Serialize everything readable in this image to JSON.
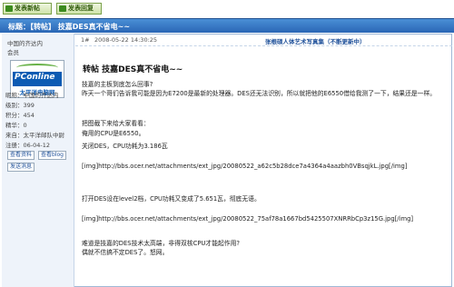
{
  "toolbar": {
    "new_post": "发表新帖",
    "reply": "发表回复"
  },
  "thread": {
    "title": "标题：【转帖】 技嘉DES真不省电~~"
  },
  "author": {
    "name": "中国的齐达内",
    "role": "会员",
    "logo_main": "PConline",
    "logo_sub": "太平洋电脑网",
    "nickname": "昵称：中国的齐达内",
    "level": "级别：399",
    "points": "积分：454",
    "essence": "精华：0",
    "from": "来自：太平洋邮队中尉",
    "registered": "注册：06-04-12",
    "btn_profile": "查看资料",
    "btn_blog": "查看blog",
    "btn_msg": "发送消息"
  },
  "post": {
    "floor": "1#",
    "date": "2008-05-22 14:30:25",
    "ad": "张根硕人体艺术写真集（不断更新中）",
    "title": "转帖  技嘉DES真不省电~~",
    "lines": [
      "技嘉的主板到底怎么回事?",
      "昨天一个哥们告诉我可能是因为E7200是最新的处理器。DES还无法识别，所以就把他的E6550借给我测了一下，结果还是一样。",
      "把图截下来给大家看看：",
      "俺用的CPU是E6550。",
      "关闭DES，CPU功耗为3.186瓦",
      "[img]http://bbs.ocer.net/attachments/ext_jpg/20080522_a62c5b28dce7a4364a4aazbh0VBsqjkL.jpg[/img]",
      "打开DES设在level2档，CPU功耗又变成了5.651瓦，彻底无语。",
      "[img]http://bbs.ocer.net/attachments/ext_jpg/20080522_75af78a1667bd5425507XNRRbCp3z15G.jpg[/img]",
      "难道是技嘉的DES技术太高端，非得双核CPU才能起作用?",
      "偶就不信搞不定DES了。怒网。"
    ]
  }
}
